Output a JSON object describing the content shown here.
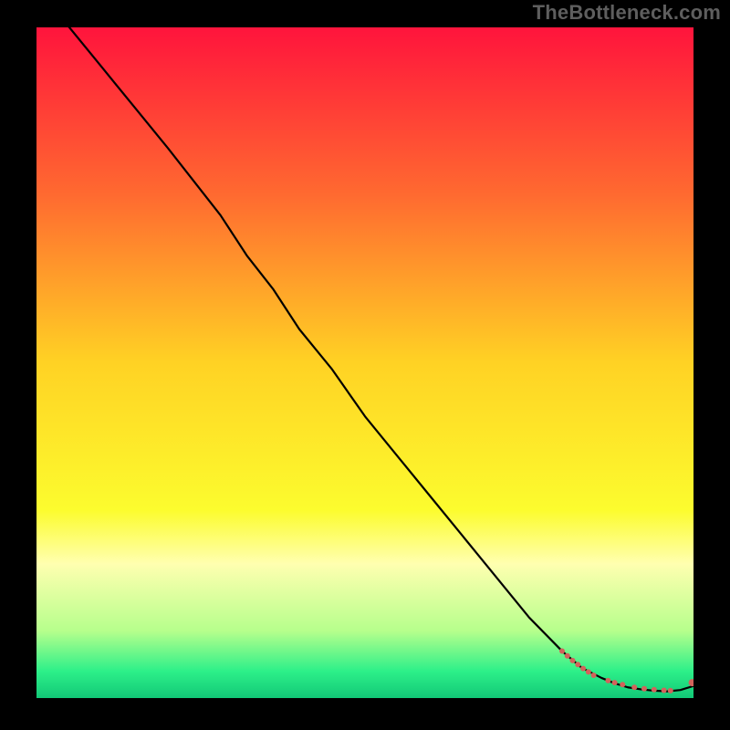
{
  "watermark": {
    "text": "TheBottleneck.com"
  },
  "chart_data": {
    "type": "line",
    "title": "",
    "xlabel": "",
    "ylabel": "",
    "xlim": [
      0,
      100
    ],
    "ylim": [
      0,
      100
    ],
    "grid": false,
    "legend": false,
    "background_gradient": {
      "description": "vertical gradient top→bottom: red→orange→yellow→pale-yellow→green",
      "stops": [
        {
          "offset": 0.0,
          "color": "#ff143c"
        },
        {
          "offset": 0.25,
          "color": "#ff6a30"
        },
        {
          "offset": 0.5,
          "color": "#ffd224"
        },
        {
          "offset": 0.72,
          "color": "#fcfc2e"
        },
        {
          "offset": 0.8,
          "color": "#ffffb0"
        },
        {
          "offset": 0.9,
          "color": "#b6ff8c"
        },
        {
          "offset": 0.96,
          "color": "#2df089"
        },
        {
          "offset": 1.0,
          "color": "#12c877"
        }
      ]
    },
    "series": [
      {
        "name": "curve",
        "type": "line",
        "color": "#000000",
        "x": [
          0,
          5,
          10,
          15,
          20,
          24,
          28,
          32,
          36,
          40,
          45,
          50,
          55,
          60,
          65,
          70,
          75,
          80,
          83,
          86,
          88,
          90,
          92,
          94,
          96,
          98,
          100
        ],
        "y": [
          105,
          100,
          94,
          88,
          82,
          77,
          72,
          66,
          61,
          55,
          49,
          42,
          36,
          30,
          24,
          18,
          12,
          7,
          4.5,
          3,
          2.2,
          1.6,
          1.3,
          1.1,
          1.0,
          1.2,
          1.8
        ]
      },
      {
        "name": "points",
        "type": "scatter",
        "color": "#d2635b",
        "x": [
          80.0,
          80.8,
          81.6,
          82.4,
          83.2,
          84.0,
          84.8,
          87.0,
          88.0,
          89.2,
          91.0,
          92.5,
          94.0,
          95.5,
          96.5,
          99.8
        ],
        "y": [
          7.0,
          6.3,
          5.6,
          5.0,
          4.4,
          3.9,
          3.4,
          2.6,
          2.3,
          2.0,
          1.6,
          1.4,
          1.25,
          1.15,
          1.1,
          2.3
        ],
        "radius": [
          3,
          3,
          3,
          3,
          3,
          3,
          3,
          3,
          3,
          3,
          3,
          3,
          3,
          3,
          3,
          4
        ]
      }
    ]
  },
  "colors": {
    "frame": "#000000",
    "curve": "#000000",
    "dots": "#d2635b"
  }
}
